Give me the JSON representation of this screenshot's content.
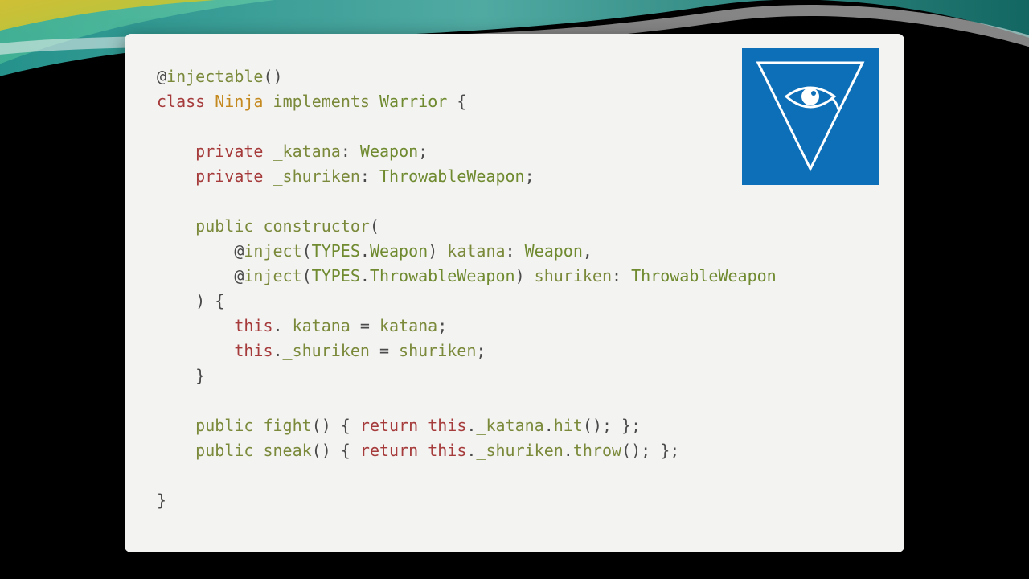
{
  "code": {
    "lines": [
      {
        "tokens": [
          {
            "c": "tok-at",
            "t": "@"
          },
          {
            "c": "tok-dec",
            "t": "injectable"
          },
          {
            "c": "tok-punc",
            "t": "()"
          }
        ]
      },
      {
        "tokens": [
          {
            "c": "tok-kw",
            "t": "class"
          },
          {
            "c": "",
            "t": " "
          },
          {
            "c": "tok-class",
            "t": "Ninja"
          },
          {
            "c": "",
            "t": " "
          },
          {
            "c": "tok-dec",
            "t": "implements"
          },
          {
            "c": "",
            "t": " "
          },
          {
            "c": "tok-type",
            "t": "Warrior"
          },
          {
            "c": "",
            "t": " "
          },
          {
            "c": "tok-punc",
            "t": "{"
          }
        ]
      },
      {
        "tokens": [
          {
            "c": "",
            "t": ""
          }
        ]
      },
      {
        "tokens": [
          {
            "c": "",
            "t": "    "
          },
          {
            "c": "tok-kw",
            "t": "private"
          },
          {
            "c": "",
            "t": " "
          },
          {
            "c": "tok-ident",
            "t": "_katana"
          },
          {
            "c": "tok-punc",
            "t": ": "
          },
          {
            "c": "tok-type",
            "t": "Weapon"
          },
          {
            "c": "tok-punc",
            "t": ";"
          }
        ]
      },
      {
        "tokens": [
          {
            "c": "",
            "t": "    "
          },
          {
            "c": "tok-kw",
            "t": "private"
          },
          {
            "c": "",
            "t": " "
          },
          {
            "c": "tok-ident",
            "t": "_shuriken"
          },
          {
            "c": "tok-punc",
            "t": ": "
          },
          {
            "c": "tok-type",
            "t": "ThrowableWeapon"
          },
          {
            "c": "tok-punc",
            "t": ";"
          }
        ]
      },
      {
        "tokens": [
          {
            "c": "",
            "t": ""
          }
        ]
      },
      {
        "tokens": [
          {
            "c": "",
            "t": "    "
          },
          {
            "c": "tok-dec",
            "t": "public"
          },
          {
            "c": "",
            "t": " "
          },
          {
            "c": "tok-ident",
            "t": "constructor"
          },
          {
            "c": "tok-punc",
            "t": "("
          }
        ]
      },
      {
        "tokens": [
          {
            "c": "",
            "t": "        "
          },
          {
            "c": "tok-at",
            "t": "@"
          },
          {
            "c": "tok-dec",
            "t": "inject"
          },
          {
            "c": "tok-punc",
            "t": "("
          },
          {
            "c": "tok-type",
            "t": "TYPES"
          },
          {
            "c": "tok-punc",
            "t": "."
          },
          {
            "c": "tok-type",
            "t": "Weapon"
          },
          {
            "c": "tok-punc",
            "t": ") "
          },
          {
            "c": "tok-ident",
            "t": "katana"
          },
          {
            "c": "tok-punc",
            "t": ": "
          },
          {
            "c": "tok-type",
            "t": "Weapon"
          },
          {
            "c": "tok-punc",
            "t": ","
          }
        ]
      },
      {
        "tokens": [
          {
            "c": "",
            "t": "        "
          },
          {
            "c": "tok-at",
            "t": "@"
          },
          {
            "c": "tok-dec",
            "t": "inject"
          },
          {
            "c": "tok-punc",
            "t": "("
          },
          {
            "c": "tok-type",
            "t": "TYPES"
          },
          {
            "c": "tok-punc",
            "t": "."
          },
          {
            "c": "tok-type",
            "t": "ThrowableWeapon"
          },
          {
            "c": "tok-punc",
            "t": ") "
          },
          {
            "c": "tok-ident",
            "t": "shuriken"
          },
          {
            "c": "tok-punc",
            "t": ": "
          },
          {
            "c": "tok-type",
            "t": "ThrowableWeapon"
          }
        ]
      },
      {
        "tokens": [
          {
            "c": "",
            "t": "    "
          },
          {
            "c": "tok-punc",
            "t": ") {"
          }
        ]
      },
      {
        "tokens": [
          {
            "c": "",
            "t": "        "
          },
          {
            "c": "tok-kw",
            "t": "this"
          },
          {
            "c": "tok-punc",
            "t": "."
          },
          {
            "c": "tok-ident",
            "t": "_katana"
          },
          {
            "c": "tok-punc",
            "t": " = "
          },
          {
            "c": "tok-ident",
            "t": "katana"
          },
          {
            "c": "tok-punc",
            "t": ";"
          }
        ]
      },
      {
        "tokens": [
          {
            "c": "",
            "t": "        "
          },
          {
            "c": "tok-kw",
            "t": "this"
          },
          {
            "c": "tok-punc",
            "t": "."
          },
          {
            "c": "tok-ident",
            "t": "_shuriken"
          },
          {
            "c": "tok-punc",
            "t": " = "
          },
          {
            "c": "tok-ident",
            "t": "shuriken"
          },
          {
            "c": "tok-punc",
            "t": ";"
          }
        ]
      },
      {
        "tokens": [
          {
            "c": "",
            "t": "    "
          },
          {
            "c": "tok-punc",
            "t": "}"
          }
        ]
      },
      {
        "tokens": [
          {
            "c": "",
            "t": ""
          }
        ]
      },
      {
        "tokens": [
          {
            "c": "",
            "t": "    "
          },
          {
            "c": "tok-dec",
            "t": "public"
          },
          {
            "c": "",
            "t": " "
          },
          {
            "c": "tok-ident",
            "t": "fight"
          },
          {
            "c": "tok-punc",
            "t": "() { "
          },
          {
            "c": "tok-kw",
            "t": "return"
          },
          {
            "c": "",
            "t": " "
          },
          {
            "c": "tok-kw",
            "t": "this"
          },
          {
            "c": "tok-punc",
            "t": "."
          },
          {
            "c": "tok-ident",
            "t": "_katana"
          },
          {
            "c": "tok-punc",
            "t": "."
          },
          {
            "c": "tok-ident",
            "t": "hit"
          },
          {
            "c": "tok-punc",
            "t": "(); };"
          }
        ]
      },
      {
        "tokens": [
          {
            "c": "",
            "t": "    "
          },
          {
            "c": "tok-dec",
            "t": "public"
          },
          {
            "c": "",
            "t": " "
          },
          {
            "c": "tok-ident",
            "t": "sneak"
          },
          {
            "c": "tok-punc",
            "t": "() { "
          },
          {
            "c": "tok-kw",
            "t": "return"
          },
          {
            "c": "",
            "t": " "
          },
          {
            "c": "tok-kw",
            "t": "this"
          },
          {
            "c": "tok-punc",
            "t": "."
          },
          {
            "c": "tok-ident",
            "t": "_shuriken"
          },
          {
            "c": "tok-punc",
            "t": "."
          },
          {
            "c": "tok-ident",
            "t": "throw"
          },
          {
            "c": "tok-punc",
            "t": "(); };"
          }
        ]
      },
      {
        "tokens": [
          {
            "c": "",
            "t": ""
          }
        ]
      },
      {
        "tokens": [
          {
            "c": "tok-punc",
            "t": "}"
          }
        ]
      }
    ]
  },
  "logo": {
    "name": "triangle-eye-logo",
    "bg": "#0d6fb8",
    "stroke": "#ffffff"
  }
}
